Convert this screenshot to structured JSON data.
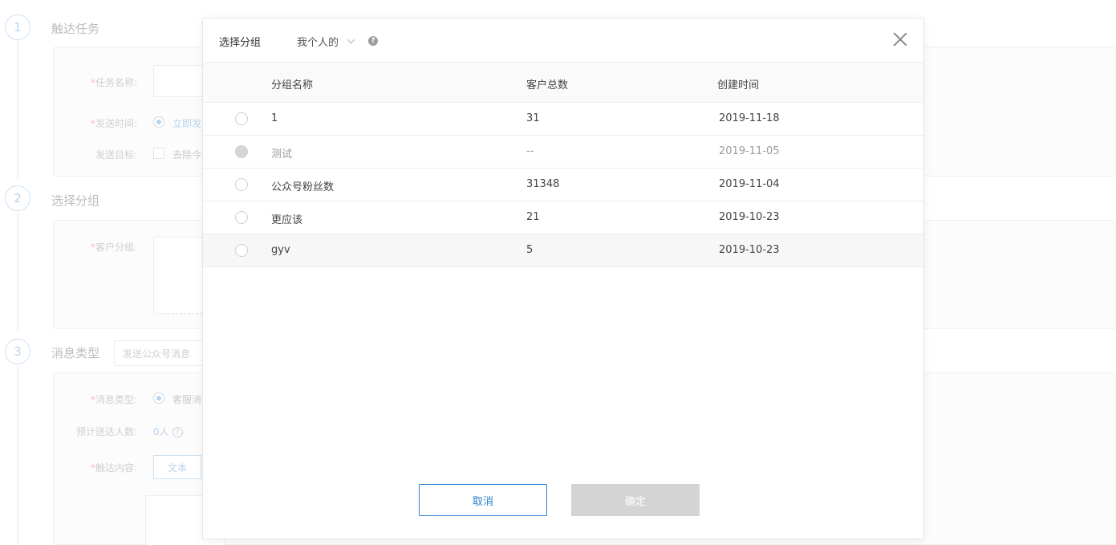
{
  "background": {
    "steps": [
      {
        "number": "1",
        "title": "触达任务"
      },
      {
        "number": "2",
        "title": "选择分组"
      },
      {
        "number": "3",
        "title": "消息类型"
      }
    ],
    "task_name_label": "任务名称:",
    "send_time_label": "发送时间:",
    "send_time_option": "立即发",
    "send_target_label": "发送目标:",
    "send_target_option": "去除今",
    "customer_group_label": "客户分组:",
    "message_type_select": "发送公众号消息",
    "message_type_label": "消息类型:",
    "message_type_option": "客服消",
    "estimated_label": "预计送达人数:",
    "estimated_value": "0人",
    "content_label": "触达内容:",
    "content_tab": "文本"
  },
  "modal": {
    "title": "选择分组",
    "scope": "我个人的",
    "help_symbol": "?",
    "columns": {
      "name": "分组名称",
      "count": "客户总数",
      "created": "创建时间"
    },
    "rows": [
      {
        "name": "1",
        "count": "31",
        "created": "2019-11-18",
        "disabled": false
      },
      {
        "name": "测试",
        "count": "--",
        "created": "2019-11-05",
        "disabled": true
      },
      {
        "name": "公众号粉丝数",
        "count": "31348",
        "created": "2019-11-04",
        "disabled": false
      },
      {
        "name": "更应该",
        "count": "21",
        "created": "2019-10-23",
        "disabled": false
      },
      {
        "name": "gyv",
        "count": "5",
        "created": "2019-10-23",
        "disabled": false
      }
    ],
    "cancel_label": "取消",
    "confirm_label": "确定"
  }
}
